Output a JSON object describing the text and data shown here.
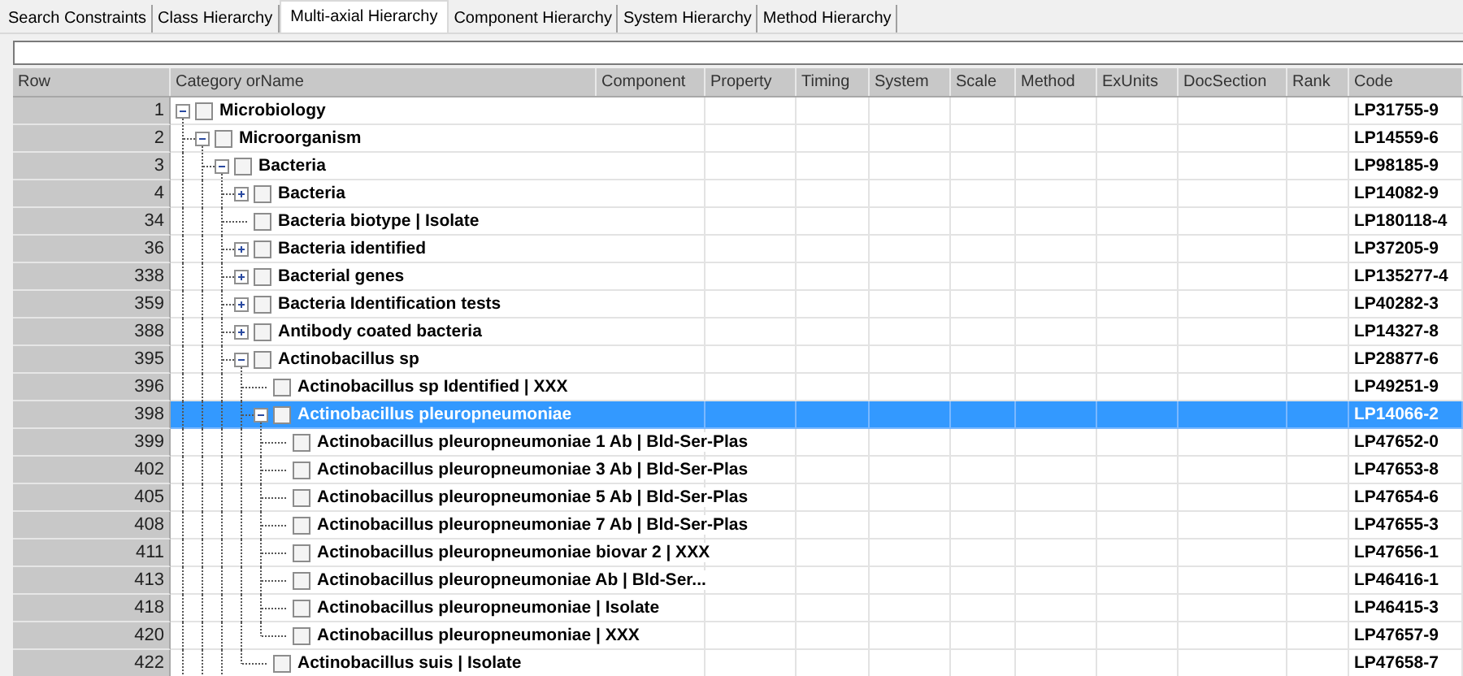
{
  "tabs": [
    {
      "label": "Search Constraints",
      "selected": false
    },
    {
      "label": "Class Hierarchy",
      "selected": false
    },
    {
      "label": "Multi-axial Hierarchy",
      "selected": true
    },
    {
      "label": "Component Hierarchy",
      "selected": false
    },
    {
      "label": "System Hierarchy",
      "selected": false
    },
    {
      "label": "Method Hierarchy",
      "selected": false
    }
  ],
  "table": {
    "columns": [
      "Row",
      "Category orName",
      "Component",
      "Property",
      "Timing",
      "System",
      "Scale",
      "Method",
      "ExUnits",
      "DocSection",
      "Rank",
      "Code"
    ],
    "rows": [
      {
        "row": "1",
        "name": "Microbiology",
        "code": "LP31755-9",
        "kind": "branch",
        "expanded": true,
        "more_children": true,
        "checked": false,
        "selected": false,
        "children": [
          {
            "row": "2",
            "name": "Microorganism",
            "code": "LP14559-6",
            "kind": "branch",
            "expanded": true,
            "more_children": true,
            "checked": false,
            "selected": false,
            "children": [
              {
                "row": "3",
                "name": "Bacteria",
                "code": "LP98185-9",
                "kind": "branch",
                "expanded": true,
                "more_children": true,
                "checked": false,
                "selected": false,
                "children": [
                  {
                    "row": "4",
                    "name": "Bacteria",
                    "code": "LP14082-9",
                    "kind": "branch",
                    "expanded": false,
                    "checked": false,
                    "selected": false
                  },
                  {
                    "row": "34",
                    "name": "Bacteria biotype | Isolate",
                    "code": "LP180118-4",
                    "kind": "leaf",
                    "checked": false,
                    "selected": false
                  },
                  {
                    "row": "36",
                    "name": "Bacteria identified",
                    "code": "LP37205-9",
                    "kind": "branch",
                    "expanded": false,
                    "checked": false,
                    "selected": false
                  },
                  {
                    "row": "338",
                    "name": "Bacterial genes",
                    "code": "LP135277-4",
                    "kind": "branch",
                    "expanded": false,
                    "checked": false,
                    "selected": false
                  },
                  {
                    "row": "359",
                    "name": "Bacteria Identification tests",
                    "code": "LP40282-3",
                    "kind": "branch",
                    "expanded": false,
                    "checked": false,
                    "selected": false
                  },
                  {
                    "row": "388",
                    "name": "Antibody coated bacteria",
                    "code": "LP14327-8",
                    "kind": "branch",
                    "expanded": false,
                    "checked": false,
                    "selected": false
                  },
                  {
                    "row": "395",
                    "name": "Actinobacillus sp",
                    "code": "LP28877-6",
                    "kind": "branch",
                    "expanded": true,
                    "more_children": false,
                    "checked": false,
                    "selected": false,
                    "children": [
                      {
                        "row": "396",
                        "name": "Actinobacillus sp Identified | XXX",
                        "code": "LP49251-9",
                        "kind": "leaf",
                        "checked": false,
                        "selected": false
                      },
                      {
                        "row": "398",
                        "name": "Actinobacillus pleuropneumoniae",
                        "code": "LP14066-2",
                        "kind": "branch",
                        "expanded": true,
                        "more_children": false,
                        "checked": false,
                        "selected": true,
                        "children": [
                          {
                            "row": "399",
                            "name": "Actinobacillus pleuropneumoniae 1 Ab | Bld-Ser-Plas",
                            "code": "LP47652-0",
                            "kind": "leaf",
                            "checked": false,
                            "selected": false
                          },
                          {
                            "row": "402",
                            "name": "Actinobacillus pleuropneumoniae 3 Ab | Bld-Ser-Plas",
                            "code": "LP47653-8",
                            "kind": "leaf",
                            "checked": false,
                            "selected": false
                          },
                          {
                            "row": "405",
                            "name": "Actinobacillus pleuropneumoniae 5 Ab | Bld-Ser-Plas",
                            "code": "LP47654-6",
                            "kind": "leaf",
                            "checked": false,
                            "selected": false
                          },
                          {
                            "row": "408",
                            "name": "Actinobacillus pleuropneumoniae 7 Ab | Bld-Ser-Plas",
                            "code": "LP47655-3",
                            "kind": "leaf",
                            "checked": false,
                            "selected": false
                          },
                          {
                            "row": "411",
                            "name": "Actinobacillus pleuropneumoniae biovar 2 | XXX",
                            "code": "LP47656-1",
                            "kind": "leaf",
                            "checked": false,
                            "selected": false
                          },
                          {
                            "row": "413",
                            "name": "Actinobacillus pleuropneumoniae Ab | Bld-Ser...",
                            "code": "LP46416-1",
                            "kind": "leaf",
                            "checked": false,
                            "selected": false
                          },
                          {
                            "row": "418",
                            "name": "Actinobacillus pleuropneumoniae | Isolate",
                            "code": "LP46415-3",
                            "kind": "leaf",
                            "checked": false,
                            "selected": false
                          },
                          {
                            "row": "420",
                            "name": "Actinobacillus pleuropneumoniae | XXX",
                            "code": "LP47657-9",
                            "kind": "leaf",
                            "checked": false,
                            "selected": false
                          }
                        ]
                      },
                      {
                        "row": "422",
                        "name": "Actinobacillus suis | Isolate",
                        "code": "LP47658-7",
                        "kind": "leaf",
                        "checked": false,
                        "selected": false
                      }
                    ]
                  }
                ]
              }
            ]
          }
        ]
      }
    ]
  }
}
